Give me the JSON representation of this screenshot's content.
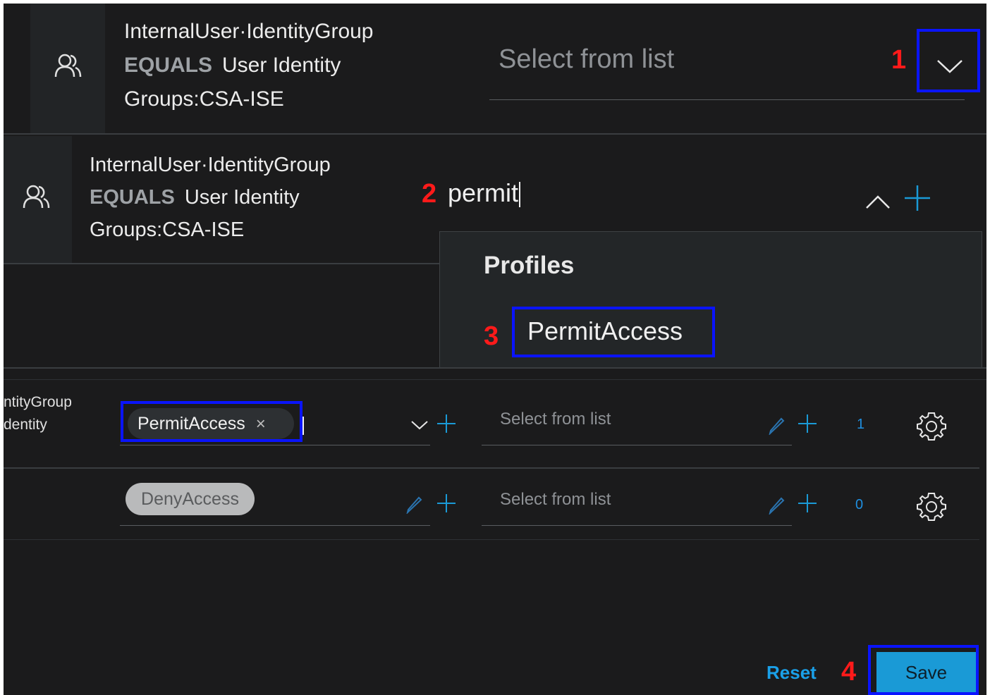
{
  "row1": {
    "condition": {
      "attribute": "InternalUser·IdentityGroup",
      "operator": "EQUALS",
      "value_line1": "User Identity",
      "value_line2": "Groups:CSA-ISE"
    },
    "select_placeholder": "Select from list"
  },
  "row2": {
    "condition": {
      "attribute": "InternalUser·IdentityGroup",
      "operator": "EQUALS",
      "value_line1": "User Identity",
      "value_line2": "Groups:CSA-ISE"
    },
    "search_value": "permit"
  },
  "dropdown": {
    "header": "Profiles",
    "option": "PermitAccess"
  },
  "row3": {
    "condition_line1": "ntityGroup",
    "condition_line2": "dentity",
    "profile_chip": "PermitAccess",
    "chip_remove": "×",
    "security_group_placeholder": "Select from list",
    "hits": "1"
  },
  "row4": {
    "profile_chip": "DenyAccess",
    "security_group_placeholder": "Select from list",
    "hits": "0"
  },
  "annotations": {
    "step1": "1",
    "step2": "2",
    "step3": "3",
    "step4": "4"
  },
  "footer": {
    "reset_label": "Reset",
    "save_label": "Save"
  },
  "colors": {
    "background": "#1b1b1c",
    "annotation_box": "#0a14ff",
    "annotation_number": "#ff1a1a",
    "accent": "#1a9ad6"
  },
  "icons": {
    "user_group": "user-group-icon",
    "gear": "gear-icon",
    "plus": "plus-icon",
    "edit": "pencil-icon"
  }
}
